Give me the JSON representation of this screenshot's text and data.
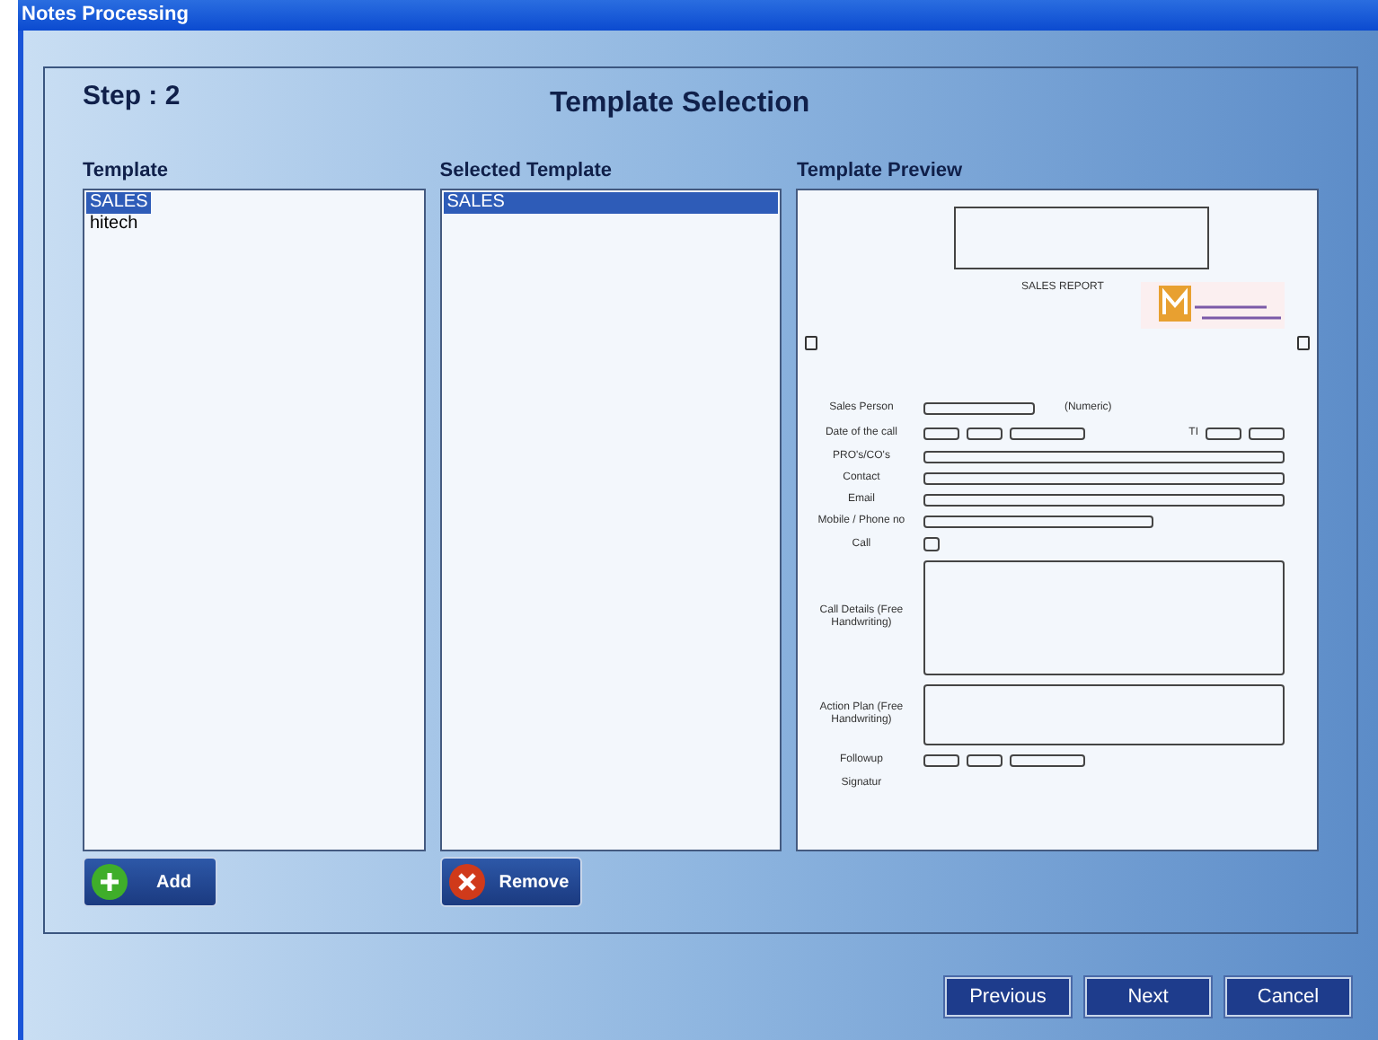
{
  "window": {
    "title": "Notes Processing"
  },
  "step": "Step : 2",
  "heading": "Template Selection",
  "template": {
    "label": "Template",
    "items": [
      {
        "text": "SALES",
        "selected": true
      },
      {
        "text": "hitech",
        "selected": false
      }
    ],
    "button": "Add"
  },
  "selected_template": {
    "label": "Selected Template",
    "items": [
      {
        "text": "SALES",
        "selected": true
      }
    ],
    "button": "Remove"
  },
  "preview": {
    "label": "Template Preview",
    "report_title": "SALES REPORT",
    "rows": [
      {
        "label": "Sales Person",
        "kind": "person",
        "note": "(Numeric)"
      },
      {
        "label": "Date of the call",
        "kind": "date",
        "note": "TI"
      },
      {
        "label": "PRO's/CO's",
        "kind": "line"
      },
      {
        "label": "Contact",
        "kind": "line"
      },
      {
        "label": "Email",
        "kind": "line"
      },
      {
        "label": "Mobile / Phone no",
        "kind": "half"
      },
      {
        "label": "Call",
        "kind": "check"
      },
      {
        "label": "Call Details (Free Handwriting)",
        "kind": "area"
      },
      {
        "label": "Action Plan (Free Handwriting)",
        "kind": "area_small"
      },
      {
        "label": "Followup",
        "kind": "date"
      },
      {
        "label": "Signatur",
        "kind": "cut"
      }
    ]
  },
  "nav_buttons": [
    "Previous",
    "Next",
    "Cancel"
  ]
}
